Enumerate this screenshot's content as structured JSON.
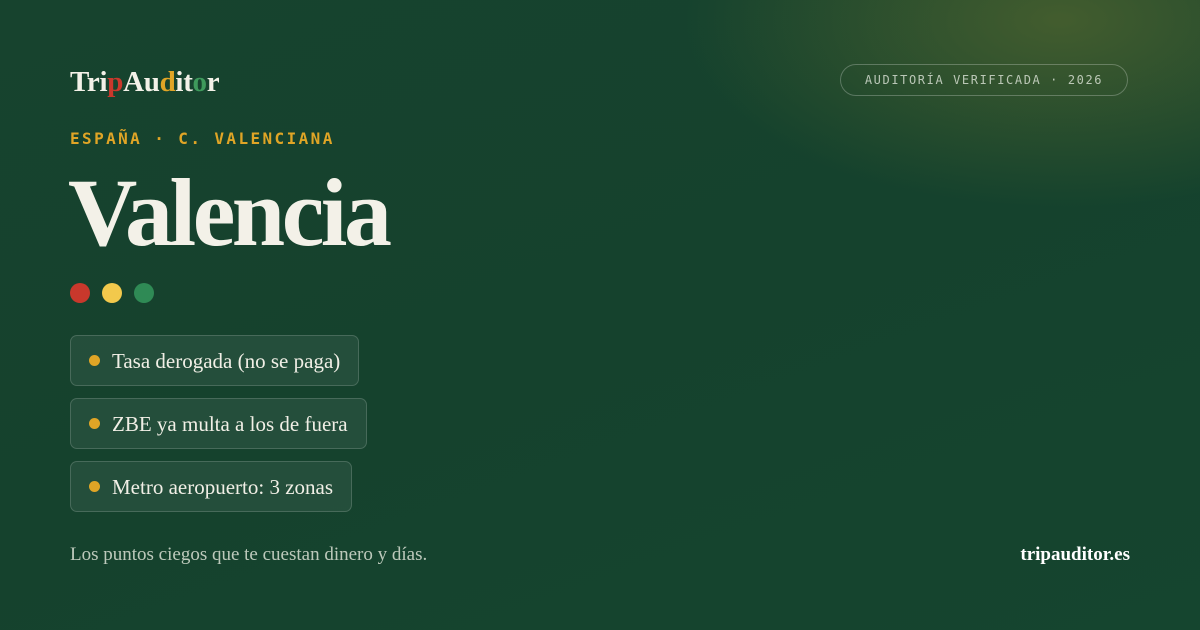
{
  "brand": {
    "letters": [
      {
        "char": "T",
        "color": "#f3f1e8"
      },
      {
        "char": "r",
        "color": "#f3f1e8"
      },
      {
        "char": "i",
        "color": "#f3f1e8"
      },
      {
        "char": "p",
        "color": "#c9382c"
      },
      {
        "char": "A",
        "color": "#f3f1e8"
      },
      {
        "char": "u",
        "color": "#f3f1e8"
      },
      {
        "char": "d",
        "color": "#e0a526"
      },
      {
        "char": "i",
        "color": "#f3f1e8"
      },
      {
        "char": "t",
        "color": "#f3f1e8"
      },
      {
        "char": "o",
        "color": "#3e9a5c"
      },
      {
        "char": "r",
        "color": "#f3f1e8"
      }
    ]
  },
  "badge": {
    "label": "AUDITORÍA VERIFICADA · 2026"
  },
  "location": {
    "region": "ESPAÑA · C. VALENCIANA",
    "city": "Valencia"
  },
  "status_dots": [
    {
      "status": "red",
      "color": "#c9382c"
    },
    {
      "status": "yellow",
      "color": "#f2c94c"
    },
    {
      "status": "green",
      "color": "#2f8a55"
    }
  ],
  "findings": [
    {
      "label": "Tasa derogada (no se paga)"
    },
    {
      "label": "ZBE ya multa a los de fuera"
    },
    {
      "label": "Metro aeropuerto: 3 zonas"
    }
  ],
  "footer": {
    "tagline": "Los puntos ciegos que te cuestan dinero y días.",
    "domain": "tripauditor.es"
  },
  "colors": {
    "accent": "#e0a526",
    "text": "#f3f1e8",
    "background": "#16402c"
  }
}
